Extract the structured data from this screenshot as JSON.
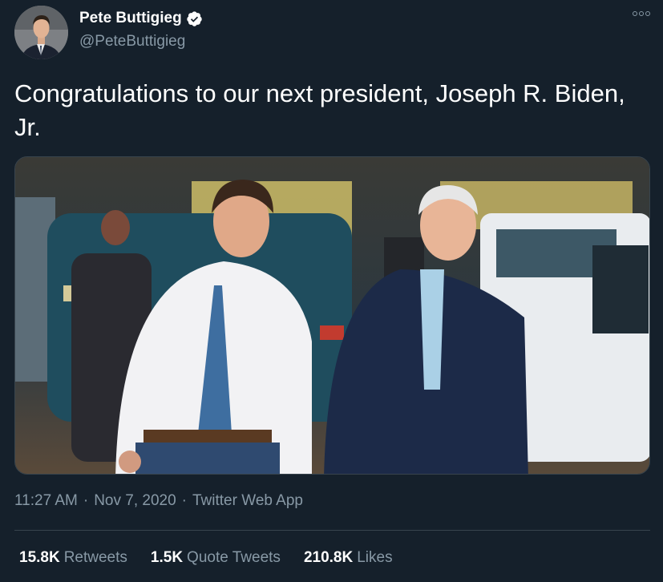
{
  "author": {
    "display_name": "Pete Buttigieg",
    "handle": "@PeteButtigieg",
    "verified": true
  },
  "tweet": {
    "text": "Congratulations to our next president, Joseph R. Biden, Jr.",
    "time": "11:27 AM",
    "date": "Nov 7, 2020",
    "source": "Twitter Web App"
  },
  "stats": {
    "retweets_count": "15.8K",
    "retweets_label": "Retweets",
    "quote_count": "1.5K",
    "quote_label": "Quote Tweets",
    "likes_count": "210.8K",
    "likes_label": "Likes"
  },
  "colors": {
    "background": "#15202b",
    "secondary_text": "#8899a6",
    "verified_blue": "#1da1f2",
    "divider": "#38444d"
  },
  "icons": {
    "verified": "verified-badge-icon",
    "more": "more-options-icon"
  }
}
